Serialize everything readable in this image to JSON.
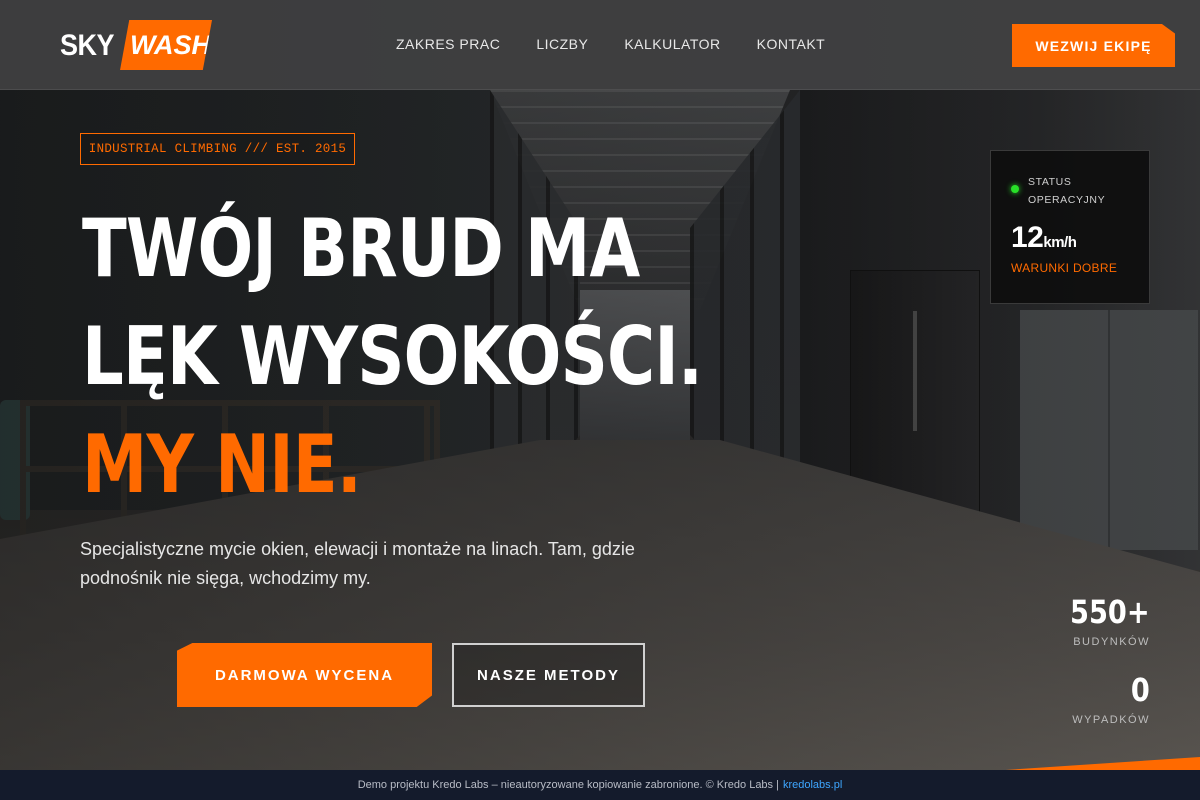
{
  "brand": {
    "logo_part1": "SKY",
    "logo_part2": "WASH",
    "accent_color": "#ff6a00"
  },
  "nav": {
    "items": [
      {
        "label": "ZAKRES PRAC"
      },
      {
        "label": "LICZBY"
      },
      {
        "label": "KALKULATOR"
      },
      {
        "label": "KONTAKT"
      }
    ],
    "cta_label": "WEZWIJ EKIPĘ"
  },
  "hero": {
    "tagline": "INDUSTRIAL CLIMBING /// EST. 2015",
    "headline_line1": "TWÓJ BRUD MA",
    "headline_line2": "LĘK WYSOKOŚCI.",
    "headline_line3": "MY NIE.",
    "subtext": "Specjalistyczne mycie okien, elewacji i montaże na linach. Tam, gdzie podnośnik nie sięga, wchodzimy my.",
    "primary_button": "DARMOWA WYCENA",
    "secondary_button": "NASZE METODY"
  },
  "status_card": {
    "status_label": "STATUS OPERACYJNY",
    "status_color": "#28e028",
    "wind_value": "12",
    "wind_unit": "km/h",
    "conditions": "WARUNKI DOBRE"
  },
  "stats": [
    {
      "value": "550+",
      "label": "BUDYNKÓW"
    },
    {
      "value": "0",
      "label": "WYPADKÓW"
    }
  ],
  "footer": {
    "text": "Demo projektu Kredo Labs – nieautoryzowane kopiowanie zabronione. © Kredo Labs |",
    "link_text": "kredolabs.pl",
    "background_color": "#141b2c"
  }
}
